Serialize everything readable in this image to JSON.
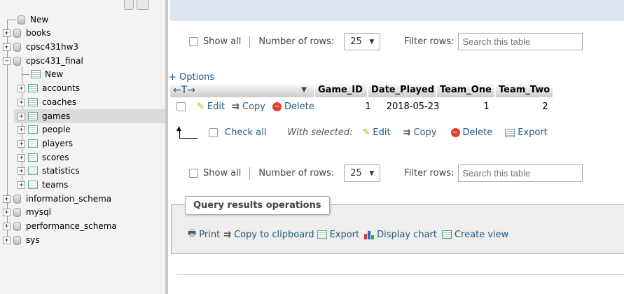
{
  "nav": {
    "new_label": "New",
    "databases": [
      {
        "name": "books",
        "expanded": false
      },
      {
        "name": "cpsc431hw3",
        "expanded": false
      },
      {
        "name": "cpsc431_final",
        "expanded": true
      },
      {
        "name": "information_schema",
        "expanded": false
      },
      {
        "name": "mysql",
        "expanded": false
      },
      {
        "name": "performance_schema",
        "expanded": false
      },
      {
        "name": "sys",
        "expanded": false
      }
    ],
    "sub_new_label": "New",
    "tables": [
      "accounts",
      "coaches",
      "games",
      "people",
      "players",
      "scores",
      "statistics",
      "teams"
    ],
    "selected_table": "games"
  },
  "controls_top": {
    "show_all": "Show all",
    "rows_label": "Number of rows:",
    "rows_value": "25",
    "filter_label": "Filter rows:",
    "filter_placeholder": "Search this table"
  },
  "options_link": "+ Options",
  "table": {
    "columns": [
      "Game_ID",
      "Date_Played",
      "Team_One",
      "Team_Two"
    ],
    "row": {
      "edit": "Edit",
      "copy": "Copy",
      "delete": "Delete",
      "game_id": "1",
      "date_played": "2018-05-23",
      "team_one": "1",
      "team_two": "2"
    }
  },
  "bulk": {
    "check_all": "Check all",
    "with_selected": "With selected:",
    "edit": "Edit",
    "copy": "Copy",
    "delete": "Delete",
    "export": "Export"
  },
  "controls_bottom": {
    "show_all": "Show all",
    "rows_label": "Number of rows:",
    "rows_value": "25",
    "filter_label": "Filter rows:",
    "filter_placeholder": "Search this table"
  },
  "query_ops": {
    "legend": "Query results operations",
    "print": "Print",
    "copy_clipboard": "Copy to clipboard",
    "export": "Export",
    "display_chart": "Display chart",
    "create_view": "Create view"
  },
  "colors": {
    "link": "#235a81",
    "nav_bg": "#f3f3f3",
    "topbar": "#dde4ee"
  }
}
